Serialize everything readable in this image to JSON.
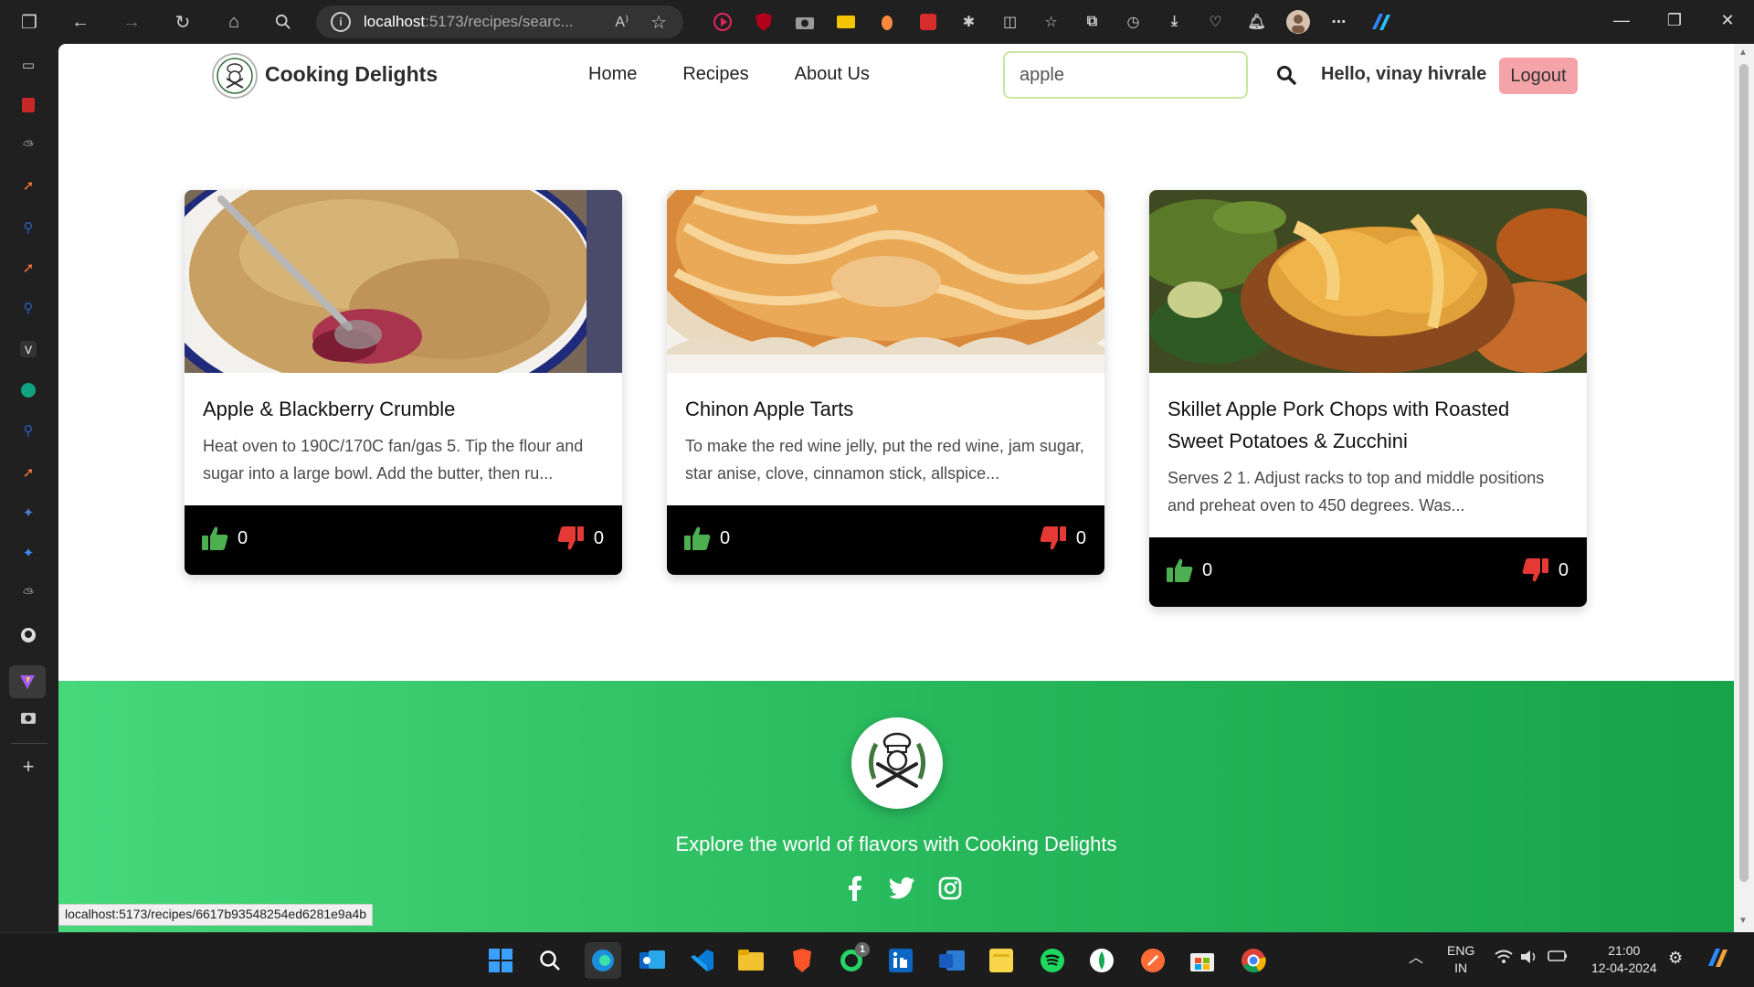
{
  "browser": {
    "url_host": "localhost",
    "url_path": ":5173/recipes/searc...",
    "read_aloud": "A⁾",
    "status_url": "localhost:5173/recipes/6617b93548254ed6281e9a4b"
  },
  "nav": {
    "brand": "Cooking Delights",
    "links": [
      "Home",
      "Recipes",
      "About Us"
    ],
    "search_value": "apple",
    "greeting": "Hello, vinay hivrale",
    "logout_label": "Logout"
  },
  "cards": [
    {
      "title": "Apple & Blackberry Crumble",
      "desc": "Heat oven to 190C/170C fan/gas 5. Tip the flour and sugar into a large bowl. Add the butter, then ru...",
      "likes": "0",
      "dislikes": "0"
    },
    {
      "title": "Chinon Apple Tarts",
      "desc": "To make the red wine jelly, put the red wine, jam sugar, star anise, clove, cinnamon stick, allspice...",
      "likes": "0",
      "dislikes": "0"
    },
    {
      "title": "Skillet Apple Pork Chops with Roasted Sweet Potatoes & Zucchini",
      "desc": "Serves 2 1. Adjust racks to top and middle positions and preheat oven to 450 degrees. Was...",
      "likes": "0",
      "dislikes": "0"
    }
  ],
  "footer": {
    "tagline": "Explore the world of flavors with Cooking Delights",
    "social_icons": [
      "facebook-icon",
      "twitter-icon",
      "instagram-icon"
    ]
  },
  "taskbar": {
    "lang": "ENG",
    "region": "IN",
    "time": "21:00",
    "date": "12-04-2024",
    "whatsapp_badge": "1"
  },
  "colors": {
    "accent_green": "#27b75b",
    "like_green": "#4caf50",
    "dislike_red": "#e53935",
    "logout_bg": "#f4a3a8",
    "search_border": "#c8e6a0"
  }
}
